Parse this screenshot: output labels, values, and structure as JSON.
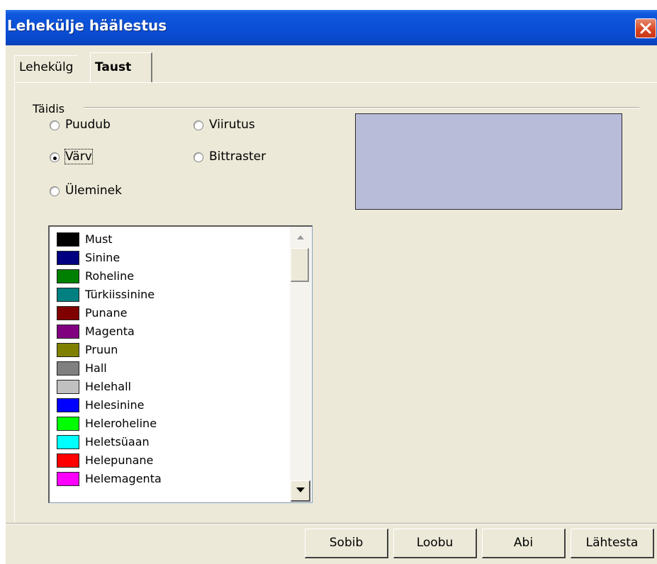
{
  "window": {
    "title": "Lehekülje häälestus",
    "close_icon": "close-x-icon"
  },
  "tabs": [
    {
      "label": "Lehekülg",
      "active": false
    },
    {
      "label": "Taust",
      "active": true
    }
  ],
  "fill_group": {
    "label": "Täidis",
    "options": {
      "none": {
        "label": "Puudub",
        "selected": false
      },
      "hatch": {
        "label": "Viirutus",
        "selected": false
      },
      "color": {
        "label": "Värv",
        "selected": true
      },
      "bitmap": {
        "label": "Bittraster",
        "selected": false
      },
      "gradient": {
        "label": "Üleminek",
        "selected": false
      }
    }
  },
  "preview": {
    "color": "#B8BCD8"
  },
  "color_list": {
    "items": [
      {
        "label": "Must",
        "color": "#000000"
      },
      {
        "label": "Sinine",
        "color": "#000080"
      },
      {
        "label": "Roheline",
        "color": "#008000"
      },
      {
        "label": "Türkiissinine",
        "color": "#008080"
      },
      {
        "label": "Punane",
        "color": "#800000"
      },
      {
        "label": "Magenta",
        "color": "#800080"
      },
      {
        "label": "Pruun",
        "color": "#808000"
      },
      {
        "label": "Hall",
        "color": "#808080"
      },
      {
        "label": "Helehall",
        "color": "#C0C0C0"
      },
      {
        "label": "Helesinine",
        "color": "#0000FF"
      },
      {
        "label": "Heleroheline",
        "color": "#00FF00"
      },
      {
        "label": "Heletsüaan",
        "color": "#00FFFF"
      },
      {
        "label": "Helepunane",
        "color": "#FF0000"
      },
      {
        "label": "Helemagenta",
        "color": "#FF00FF"
      }
    ]
  },
  "buttons": {
    "ok": "Sobib",
    "cancel": "Loobu",
    "help": "Abi",
    "reset": "Lähtesta"
  }
}
